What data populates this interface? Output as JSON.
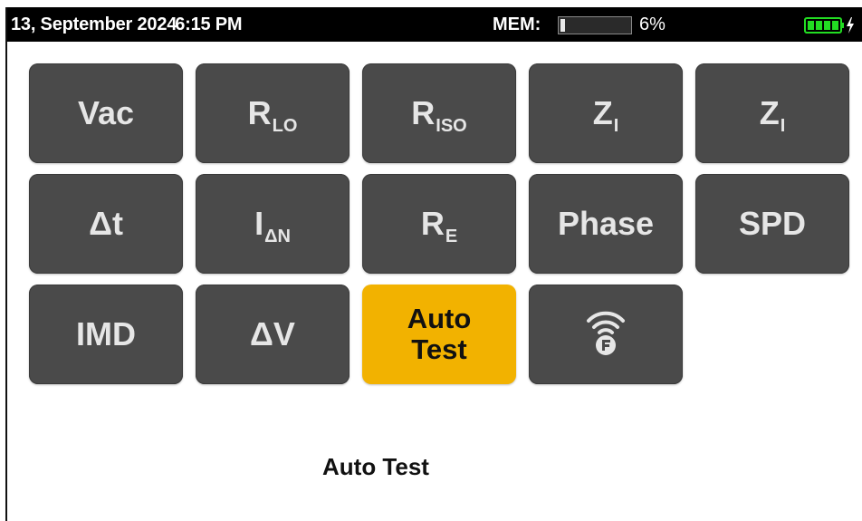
{
  "status_bar": {
    "date": "13, September 2024",
    "time": "6:15 PM",
    "mem_label": "MEM:",
    "mem_value": "6%",
    "mem_fraction": 0.06,
    "battery_icon": "battery-charging-icon",
    "battery_color": "#22dd22"
  },
  "tiles": [
    {
      "name": "vac",
      "main": "Vac",
      "sub": ""
    },
    {
      "name": "rlo",
      "main": "R",
      "sub": "LO"
    },
    {
      "name": "riso",
      "main": "R",
      "sub": "ISO"
    },
    {
      "name": "zi-1",
      "main": "Z",
      "sub": "I"
    },
    {
      "name": "zi-2",
      "main": "Z",
      "sub": "I"
    },
    {
      "name": "delta-t",
      "main": "Δt",
      "sub": ""
    },
    {
      "name": "i-delta-n",
      "main": "I",
      "sub": "ΔN"
    },
    {
      "name": "re",
      "main": "R",
      "sub": "E"
    },
    {
      "name": "phase",
      "main": "Phase",
      "sub": ""
    },
    {
      "name": "spd",
      "main": "SPD",
      "sub": ""
    },
    {
      "name": "imd",
      "main": "IMD",
      "sub": ""
    },
    {
      "name": "delta-v",
      "main": "ΔV",
      "sub": ""
    },
    {
      "name": "auto-test",
      "main": "Auto\nTest",
      "sub": "",
      "active": true
    },
    {
      "name": "wireless",
      "icon": "wireless-f-icon"
    }
  ],
  "caption": "Auto Test",
  "colors": {
    "tile": "#4a4a4a",
    "active_tile": "#f2b200",
    "status_bar": "#000000"
  }
}
